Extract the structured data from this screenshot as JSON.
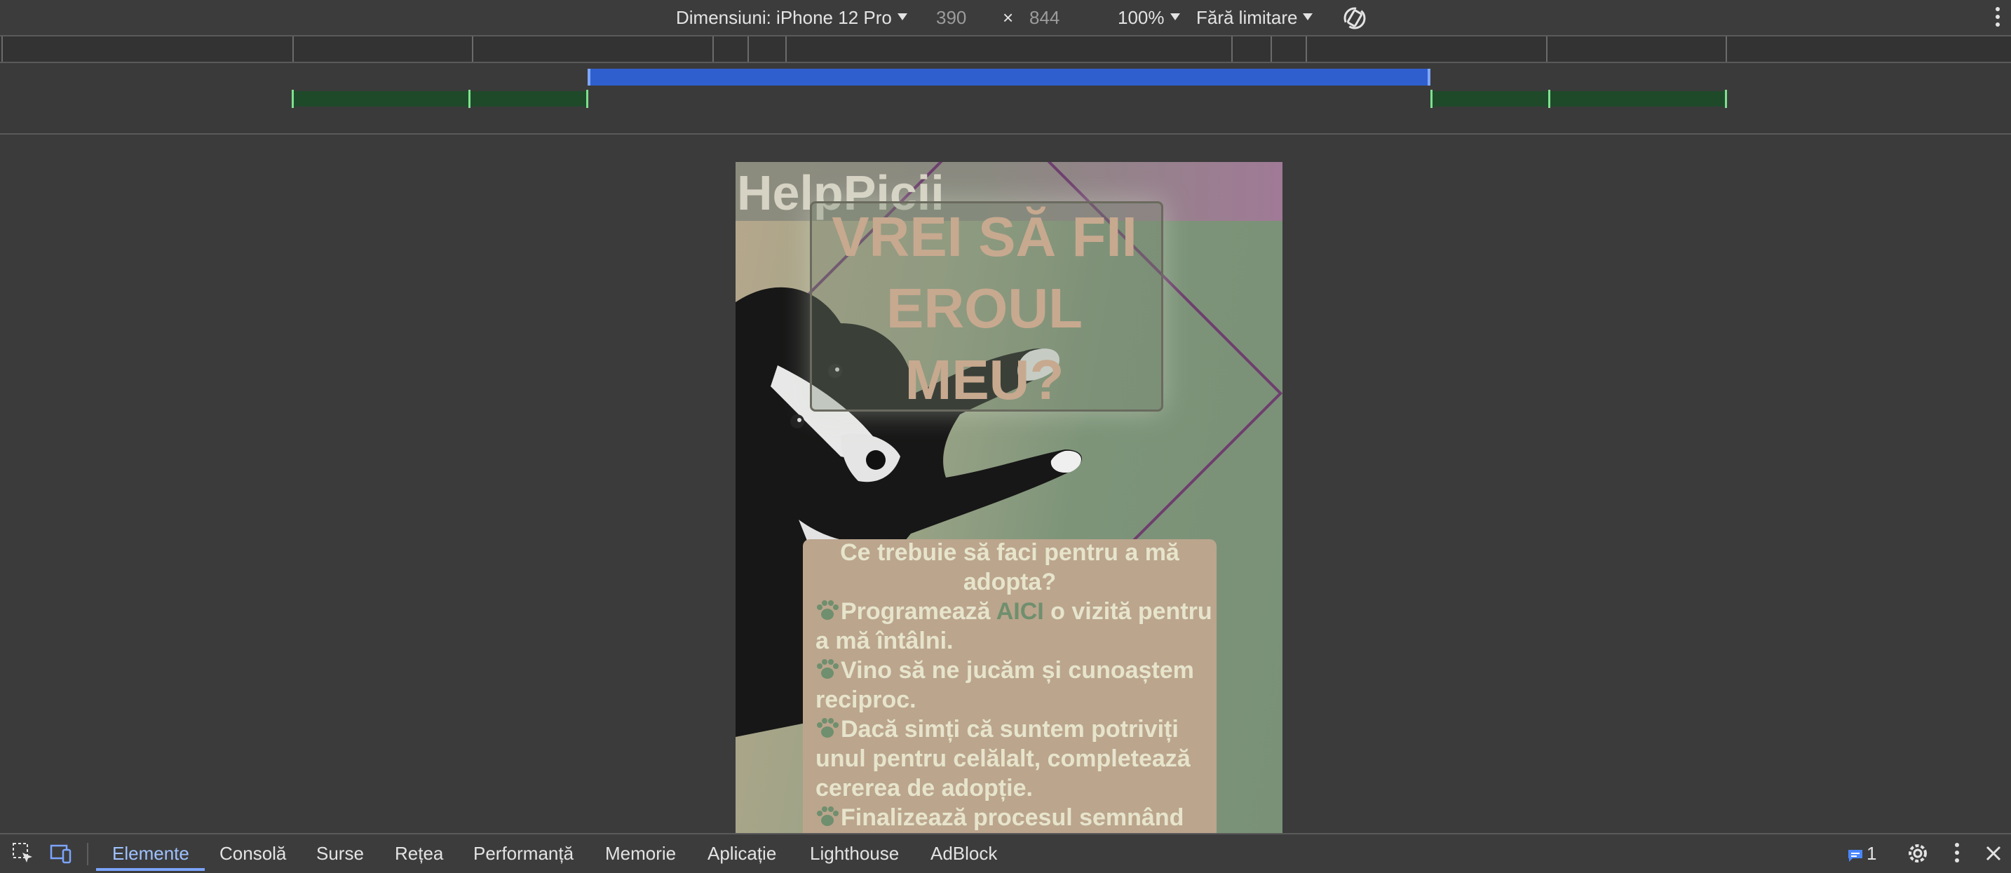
{
  "toolbar": {
    "dimensions_label": "Dimensiuni: iPhone 12 Pro",
    "width_value": "390",
    "times_symbol": "×",
    "height_value": "844",
    "zoom": "100%",
    "throttle": "Fără limitare"
  },
  "page": {
    "logo": "HelpPicii",
    "hero_line1": "VREI SĂ FII",
    "hero_line2": "EROUL",
    "hero_line3": "MEU?",
    "info_title": "Ce trebuie să faci pentru a mă adopta?",
    "step1_before": "Programează ",
    "step1_link": "AICI",
    "step1_after": " o vizită pentru a mă întâlni.",
    "step2": "Vino să ne jucăm și cunoaștem reciproc.",
    "step3": "Dacă simți că suntem potriviți unul pentru celălalt, completează cererea de adopție.",
    "step4": "Finalizează procesul semnând"
  },
  "devtools": {
    "tabs": [
      "Elemente",
      "Consolă",
      "Surse",
      "Rețea",
      "Performanță",
      "Memorie",
      "Aplicație",
      "Lighthouse",
      "AdBlock"
    ],
    "issues_count": "1"
  },
  "colors": {
    "accent_blue": "#2f5fce",
    "active_tab": "#9fc1ff",
    "media_green": "#7ee08e"
  }
}
